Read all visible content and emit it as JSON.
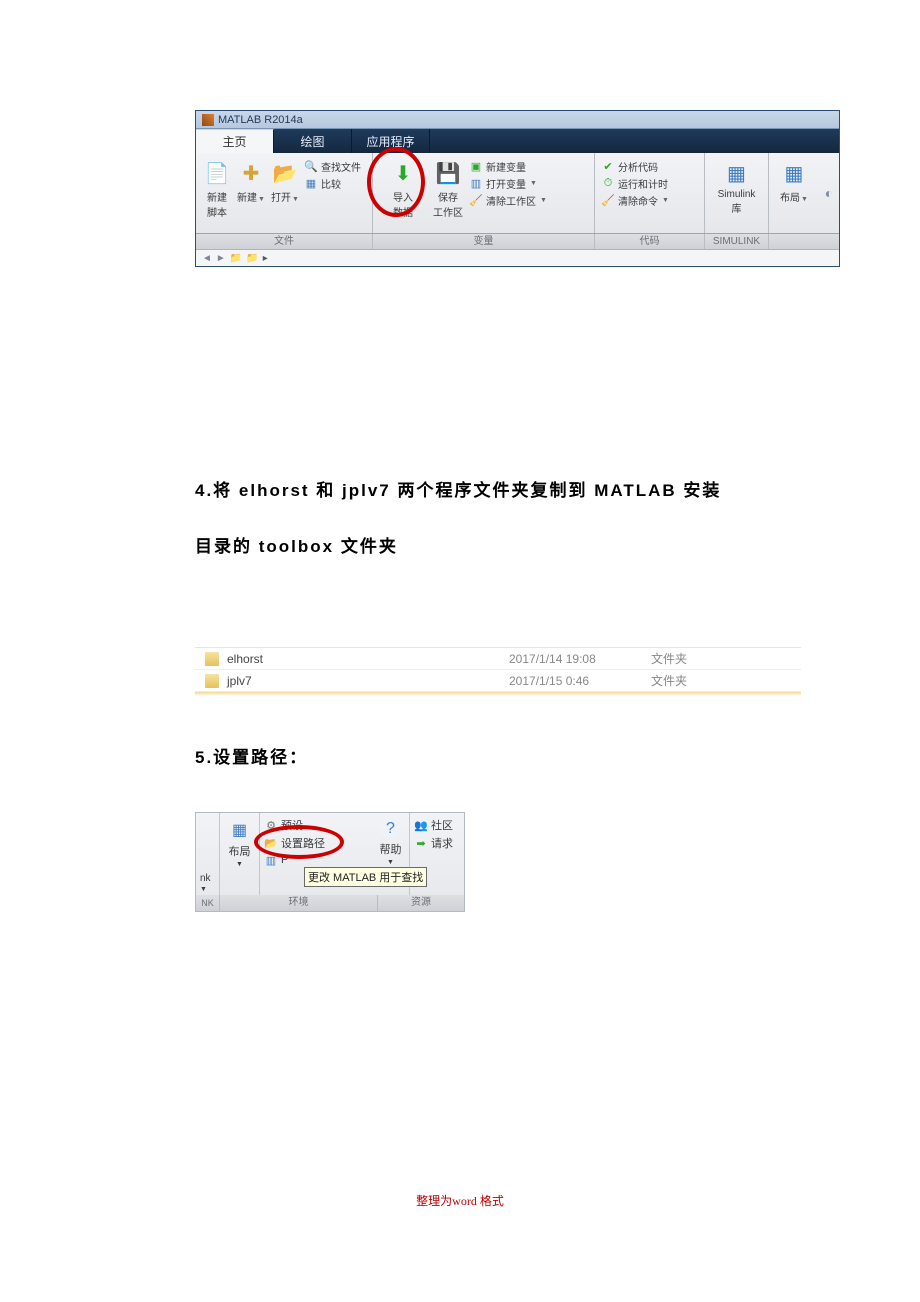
{
  "matlab": {
    "title": "MATLAB R2014a",
    "tabs": {
      "home": "主页",
      "plot": "绘图",
      "apps": "应用程序"
    },
    "file": {
      "new_script": "新建\n脚本",
      "new": "新建",
      "open": "打开",
      "find_files": "查找文件",
      "compare": "比较",
      "section_label": "文件"
    },
    "var": {
      "import": "导入\n数据",
      "save_ws": "保存\n工作区",
      "new_var": "新建变量",
      "open_var": "打开变量",
      "clear_ws": "清除工作区",
      "section_label": "变量"
    },
    "code": {
      "analyze": "分析代码",
      "run_time": "运行和计时",
      "clear_cmd": "清除命令",
      "section_label": "代码"
    },
    "simulink": {
      "label": "Simulink\n库",
      "section_label": "SIMULINK"
    },
    "layout": "布局"
  },
  "step4": "4.将 elhorst 和 jplv7 两个程序文件夹复制到 MATLAB 安装目录的 toolbox 文件夹",
  "folders": [
    {
      "name": "elhorst",
      "date": "2017/1/14 19:08",
      "type": "文件夹"
    },
    {
      "name": "jplv7",
      "date": "2017/1/15 0:46",
      "type": "文件夹"
    }
  ],
  "step5": "5.设置路径：",
  "setpath": {
    "nk_suffix": "nk",
    "layout": "布局",
    "presets": "预设",
    "set_path": "设置路径",
    "p_mark": "P",
    "help": "帮助",
    "social": "社区",
    "req": "请求",
    "tooltip": "更改 MATLAB 用于查找",
    "NK": "NK",
    "env_label": "环境",
    "res_label": "资源"
  },
  "footer": {
    "text": "整理为",
    "word": "word",
    "fmt": "格式"
  }
}
